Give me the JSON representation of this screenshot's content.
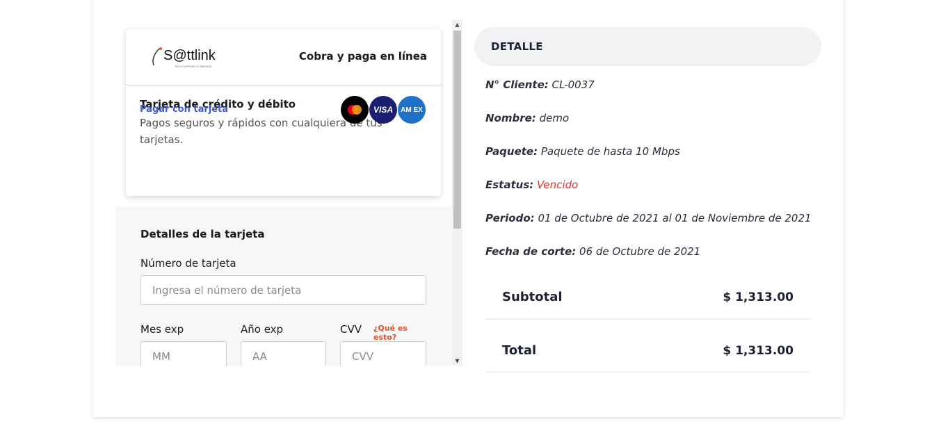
{
  "payment_widget": {
    "brand_logo_text": "S@ttlink",
    "brand_tagline": "TECH SUPPORT & SERVICE",
    "header_tag": "Cobra y paga en línea",
    "method_title": "Tarjeta de crédito y débito",
    "method_description": "Pagos seguros y rápidos con cualquiera de tus tarjetas.",
    "pay_link": "Pagar con tarjeta",
    "card_icons": [
      "mastercard-icon",
      "visa-icon",
      "amex-icon"
    ],
    "visa_text": "VISA",
    "amex_text": "AM EX",
    "form": {
      "title": "Detalles de la tarjeta",
      "card_number_label": "Número de tarjeta",
      "card_number_placeholder": "Ingresa el número de tarjeta",
      "month_label": "Mes exp",
      "month_placeholder": "MM",
      "year_label": "Año exp",
      "year_placeholder": "AA",
      "cvv_label": "CVV",
      "cvv_help": "¿Qué es esto?",
      "cvv_placeholder": "CVV"
    }
  },
  "detail": {
    "header": "DETALLE",
    "client_label": "N° Cliente:",
    "client_value": "CL-0037",
    "name_label": "Nombre:",
    "name_value": "demo",
    "package_label": "Paquete:",
    "package_value": "Paquete de hasta 10 Mbps",
    "status_label": "Estatus:",
    "status_value": "Vencido",
    "period_label": "Periodo:",
    "period_value": "01 de Octubre de 2021 al 01 de Noviembre de 2021",
    "cutoff_label": "Fecha de corte:",
    "cutoff_value": "06 de Octubre de 2021",
    "subtotal_label": "Subtotal",
    "subtotal_value": "$ 1,313.00",
    "total_label": "Total",
    "total_value": "$ 1,313.00"
  },
  "colors": {
    "link_blue": "#4159c9",
    "status_red": "#e03131",
    "cvv_help_orange": "#e0532a",
    "detail_header_bg": "#f1f2f4"
  }
}
